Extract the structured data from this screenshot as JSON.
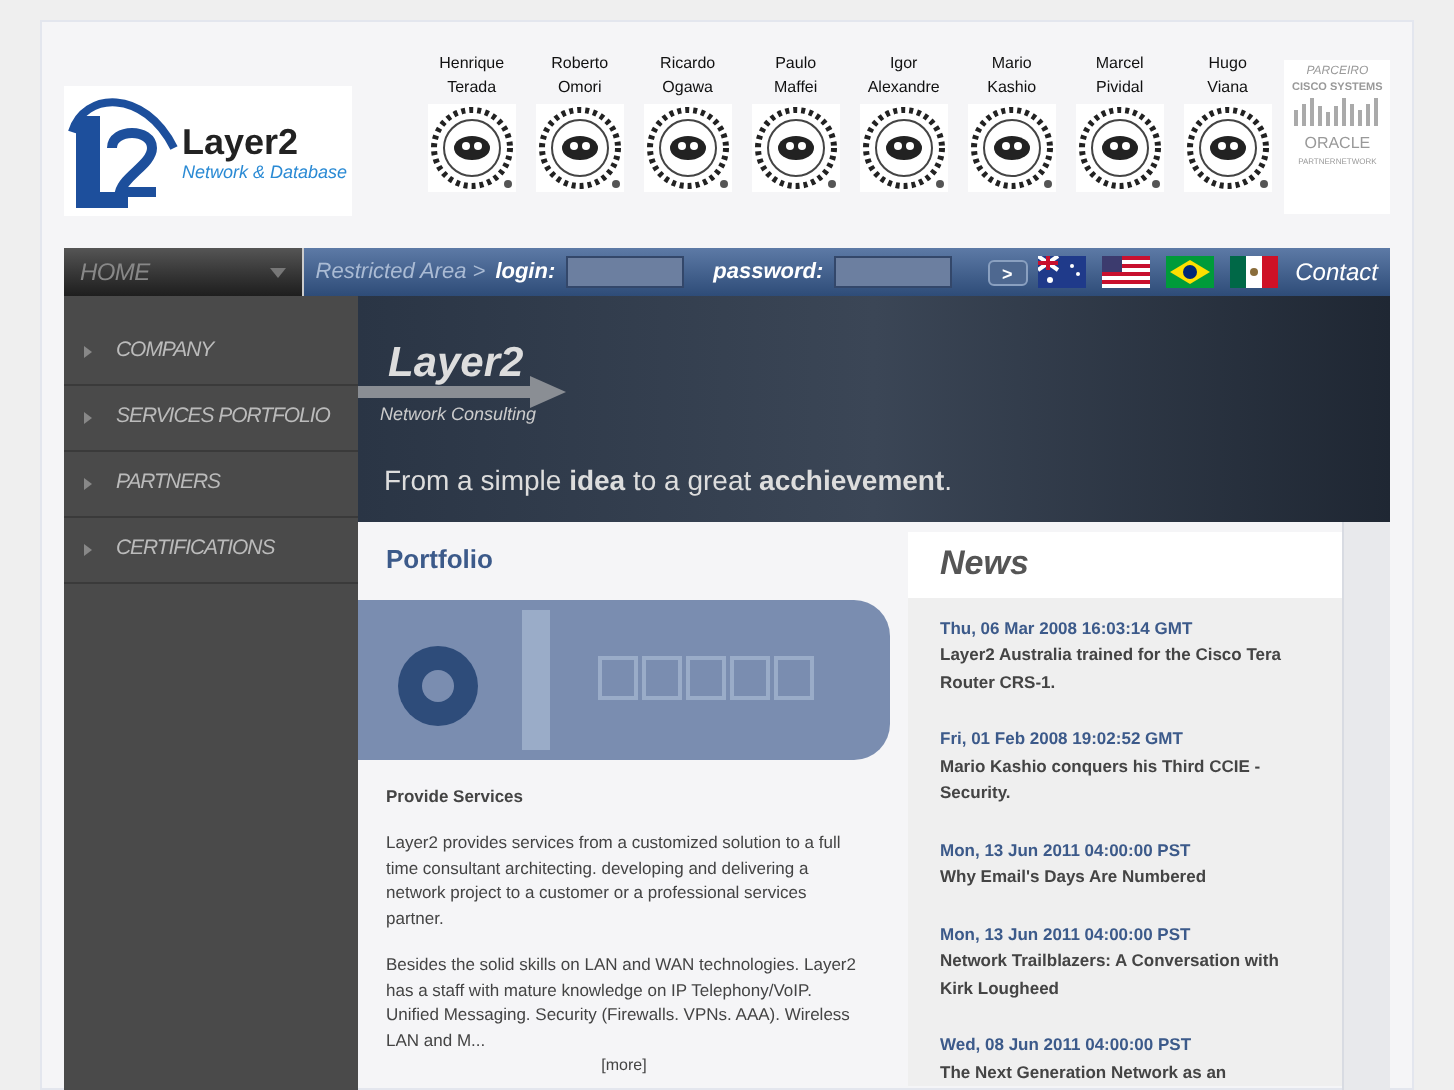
{
  "logo": {
    "name": "Layer2",
    "tagline": "Network & Database"
  },
  "engineers": [
    {
      "first": "Henrique",
      "last": "Terada"
    },
    {
      "first": "Roberto",
      "last": "Omori"
    },
    {
      "first": "Ricardo",
      "last": "Ogawa"
    },
    {
      "first": "Paulo",
      "last": "Maffei"
    },
    {
      "first": "Igor",
      "last": "Alexandre"
    },
    {
      "first": "Mario",
      "last": "Kashio"
    },
    {
      "first": "Marcel",
      "last": "Pividal"
    },
    {
      "first": "Hugo",
      "last": "Viana"
    }
  ],
  "partner_logo": {
    "label": "PARCEIRO",
    "cisco": "CISCO SYSTEMS",
    "oracle": "ORACLE",
    "oracle_sub": "PARTNERNETWORK"
  },
  "nav": {
    "home": "HOME",
    "restricted": "Restricted Area >",
    "login_label": "login:",
    "password_label": "password:",
    "go": ">",
    "flags": [
      {
        "kind": "australia"
      },
      {
        "kind": "usa"
      },
      {
        "kind": "brazil"
      },
      {
        "kind": "mexico"
      }
    ],
    "contact": "Contact"
  },
  "sidebar": {
    "items": [
      "COMPANY",
      "SERVICES PORTFOLIO",
      "PARTNERS",
      "CERTIFICATIONS"
    ]
  },
  "banner": {
    "title": "Layer2",
    "subtitle": "Network Consulting",
    "slogan": "From a simple **idea** to a great **acchievement**."
  },
  "portfolio": {
    "heading": "Portfolio",
    "subheading": "Provide Services",
    "paragraphs": [
      "Layer2 provides services from a customized solution to a full time consultant architecting. developing and delivering a network project to a customer or a professional services partner.",
      "Besides the solid skills on LAN and WAN technologies. Layer2 has a staff with mature knowledge on IP Telephony/VoIP. Unified Messaging. Security (Firewalls. VPNs. AAA). Wireless LAN and M..."
    ],
    "more": "[more]"
  },
  "news": {
    "heading": "News",
    "items": [
      {
        "date": "Thu, 06 Mar 2008 16:03:14 GMT",
        "title": "Layer2 Australia trained for the Cisco Tera Router CRS-1."
      },
      {
        "date": "Fri, 01 Feb 2008 19:02:52 GMT",
        "title": "Mario Kashio conquers his Third CCIE - Security."
      },
      {
        "date": "Mon, 13 Jun 2011 04:00:00 PST",
        "title": "Why Email's Days Are Numbered"
      },
      {
        "date": "Mon, 13 Jun 2011 04:00:00 PST",
        "title": "Network Trailblazers: A Conversation with Kirk Lougheed"
      },
      {
        "date": "Wed, 08 Jun 2011 04:00:00 PST",
        "title": "The Next Generation Network as an"
      }
    ]
  }
}
